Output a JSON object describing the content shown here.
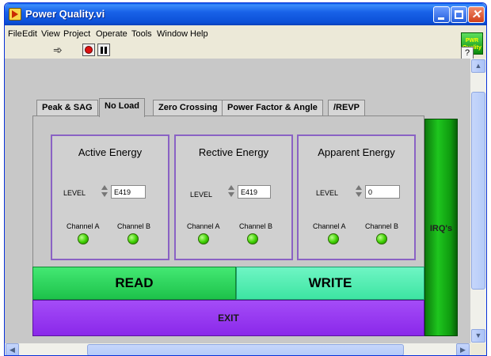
{
  "window": {
    "title": "Power Quality.vi",
    "help_label": "?",
    "logo_text": "PWR Quality"
  },
  "menu": [
    "File",
    "Edit",
    "View",
    "Project",
    "Operate",
    "Tools",
    "Window",
    "Help"
  ],
  "tabs": [
    {
      "label": "Peak & SAG",
      "active": false
    },
    {
      "label": "No Load",
      "active": true
    },
    {
      "label": "Zero Crossing",
      "active": false
    },
    {
      "label": "Power Factor & Angle",
      "active": false
    },
    {
      "label": "/REVP",
      "active": false
    }
  ],
  "cards": [
    {
      "title": "Active Energy",
      "level_label": "LEVEL",
      "level_value": "E419",
      "channel_a": "Channel A",
      "channel_b": "Channel B"
    },
    {
      "title": "Rective Energy",
      "level_label": "LEVEL",
      "level_value": "E419",
      "channel_a": "Channel A",
      "channel_b": "Channel B"
    },
    {
      "title": "Apparent Energy",
      "level_label": "LEVEL",
      "level_value": "0",
      "channel_a": "Channel A",
      "channel_b": "Channel B"
    }
  ],
  "buttons": {
    "irq": "IRQ's",
    "read": "READ",
    "write": "WRITE",
    "exit": "EXIT"
  },
  "colors": {
    "titlebar": "#1862e8",
    "panel": "#c8c8c8",
    "card_border": "#8a62c4",
    "read": "#1dc24a",
    "write": "#3de5a2",
    "exit": "#8a28ea",
    "irq": "#1ec61e",
    "led_on": "#3ed000"
  }
}
